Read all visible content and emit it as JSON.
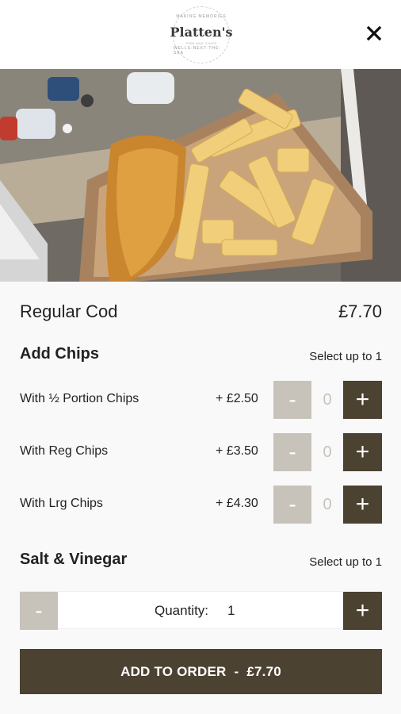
{
  "header": {
    "logo_top": "MAKING MEMORIES",
    "logo_name": "Platten's",
    "logo_sub": "FISH AND CHIPS",
    "logo_bottom": "WELLS-NEXT-THE-SEA"
  },
  "item": {
    "name": "Regular Cod",
    "price": "£7.70"
  },
  "sections": {
    "chips": {
      "title": "Add Chips",
      "note": "Select up to 1",
      "options": [
        {
          "label": "With ½ Portion Chips",
          "price": "+ £2.50",
          "count": "0",
          "minus": "-",
          "plus": "+"
        },
        {
          "label": "With Reg Chips",
          "price": "+ £3.50",
          "count": "0",
          "minus": "-",
          "plus": "+"
        },
        {
          "label": "With Lrg Chips",
          "price": "+ £4.30",
          "count": "0",
          "minus": "-",
          "plus": "+"
        }
      ]
    },
    "salt": {
      "title": "Salt & Vinegar",
      "note": "Select up to 1"
    }
  },
  "quantity": {
    "label": "Quantity:",
    "value": "1",
    "minus": "-",
    "plus": "+"
  },
  "cta": {
    "label": "ADD TO ORDER",
    "separator": "-",
    "price": "£7.70"
  },
  "icons": {
    "close": "close-icon"
  },
  "colors": {
    "accent": "#4c4232",
    "disabled": "#c7c3bb",
    "background": "#f9f9f9"
  }
}
